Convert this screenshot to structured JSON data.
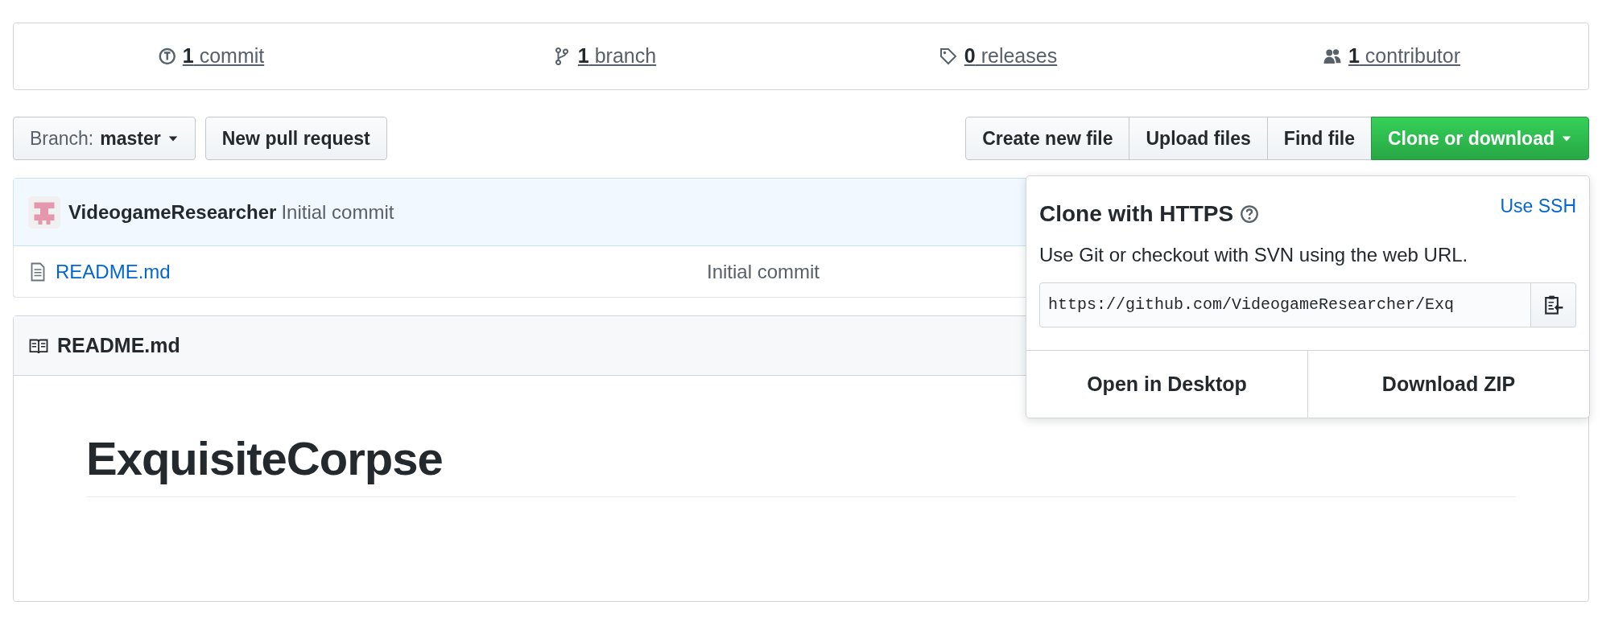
{
  "summary": [
    {
      "kind": "commits",
      "count": "1",
      "label": "commit"
    },
    {
      "kind": "branches",
      "count": "1",
      "label": "branch"
    },
    {
      "kind": "releases",
      "count": "0",
      "label": "releases"
    },
    {
      "kind": "contributors",
      "count": "1",
      "label": "contributor"
    }
  ],
  "branch_button": {
    "prefix": "Branch:",
    "value": "master"
  },
  "pull_request_button": "New pull request",
  "file_buttons": [
    "Create new file",
    "Upload files",
    "Find file"
  ],
  "clone_button": "Clone or download",
  "commit": {
    "author": "VideogameResearcher",
    "message": "Initial commit"
  },
  "files": [
    {
      "name": "README.md",
      "message": "Initial commit"
    }
  ],
  "readme": {
    "title": "README.md",
    "heading": "ExquisiteCorpse"
  },
  "clone_popup": {
    "title": "Clone with HTTPS",
    "switch_link": "Use SSH",
    "description": "Use Git or checkout with SVN using the web URL.",
    "url": "https://github.com/VideogameResearcher/Exq",
    "actions": [
      "Open in Desktop",
      "Download ZIP"
    ]
  }
}
